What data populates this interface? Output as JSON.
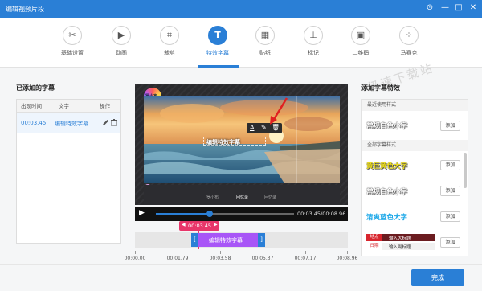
{
  "window": {
    "title": "编辑视频片段",
    "controls": [
      "⊙",
      "—",
      "□",
      "✕"
    ]
  },
  "toolbar": {
    "tools": [
      {
        "label": "基础设置",
        "icon": "scissors-icon",
        "glyph": "✂"
      },
      {
        "label": "动画",
        "icon": "play-icon",
        "glyph": "▶"
      },
      {
        "label": "裁剪",
        "icon": "crop-icon",
        "glyph": "⌗"
      },
      {
        "label": "特效字幕",
        "icon": "text-icon",
        "glyph": "T"
      },
      {
        "label": "贴纸",
        "icon": "image-icon",
        "glyph": "▦"
      },
      {
        "label": "标记",
        "icon": "pin-icon",
        "glyph": "⊥"
      },
      {
        "label": "二维码",
        "icon": "qrcode-icon",
        "glyph": "▣"
      },
      {
        "label": "马赛克",
        "icon": "mosaic-icon",
        "glyph": "⁘"
      }
    ],
    "active": "特效字幕"
  },
  "watermark": "极速下载站",
  "left": {
    "heading": "已添加的字幕",
    "columns": [
      "出现时间",
      "文字",
      "操作"
    ],
    "rows": [
      {
        "time": "00:03.45",
        "text": "编辑特效字幕"
      }
    ]
  },
  "preview": {
    "badge": "罗小布",
    "subtitle": "编辑特效字幕",
    "toolbar_glyphs": [
      "A",
      "✎",
      "🗑"
    ],
    "inner_labels": [
      "罗小布",
      "回忆录",
      "回忆录"
    ],
    "time": "00:03.45/00:08.96",
    "progress": 0.39
  },
  "timeline": {
    "marker": "00:03.45",
    "clip_label": "编辑特效字幕",
    "ticks": [
      "00:00.00",
      "00:01.79",
      "00:03.58",
      "00:05.37",
      "00:07.17",
      "00:08.96"
    ]
  },
  "right": {
    "heading": "添加字幕特效",
    "recent_label": "最近使用样式",
    "all_label": "全部字幕样式",
    "add_label": "添加",
    "recent": [
      {
        "text": "常规白色小字",
        "color": "#ffffff"
      }
    ],
    "styles": [
      {
        "text": "黄巨黄色大字",
        "color": "#f2e21b"
      },
      {
        "text": "常规白色小字",
        "color": "#ffffff"
      },
      {
        "text": "清爽蓝色大字",
        "color": "#1aa7e8"
      }
    ],
    "partial": {
      "tag1": "地点",
      "tag2": "日期",
      "line1": "输入大标题",
      "line2": "输入副标题"
    }
  },
  "footer": {
    "finish": "完成"
  },
  "colors": {
    "accent": "#2a7fd6",
    "marker": "#e8366a",
    "clip": "#a855f7"
  }
}
